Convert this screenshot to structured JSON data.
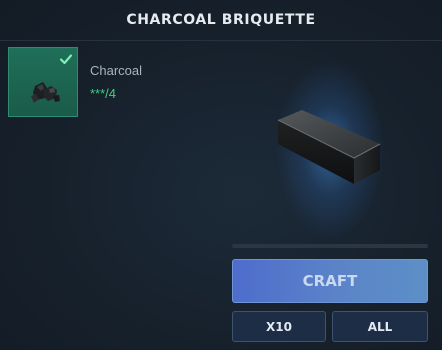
{
  "title": "CHARCOAL BRIQUETTE",
  "ingredients": [
    {
      "name": "Charcoal",
      "count": "***/4",
      "icon": "charcoal-icon",
      "status": "check-icon"
    }
  ],
  "result": {
    "icon": "charcoal-briquette-icon"
  },
  "progress": {
    "fraction": 0
  },
  "buttons": {
    "craft": "CRAFT",
    "x10": "X10",
    "all": "ALL"
  },
  "colors": {
    "background": "#17202b",
    "slot_green": "#1f6f59",
    "count_green": "#3fcf7c",
    "craft_blue": "#5b84c8",
    "small_button": "#1c2d45"
  }
}
